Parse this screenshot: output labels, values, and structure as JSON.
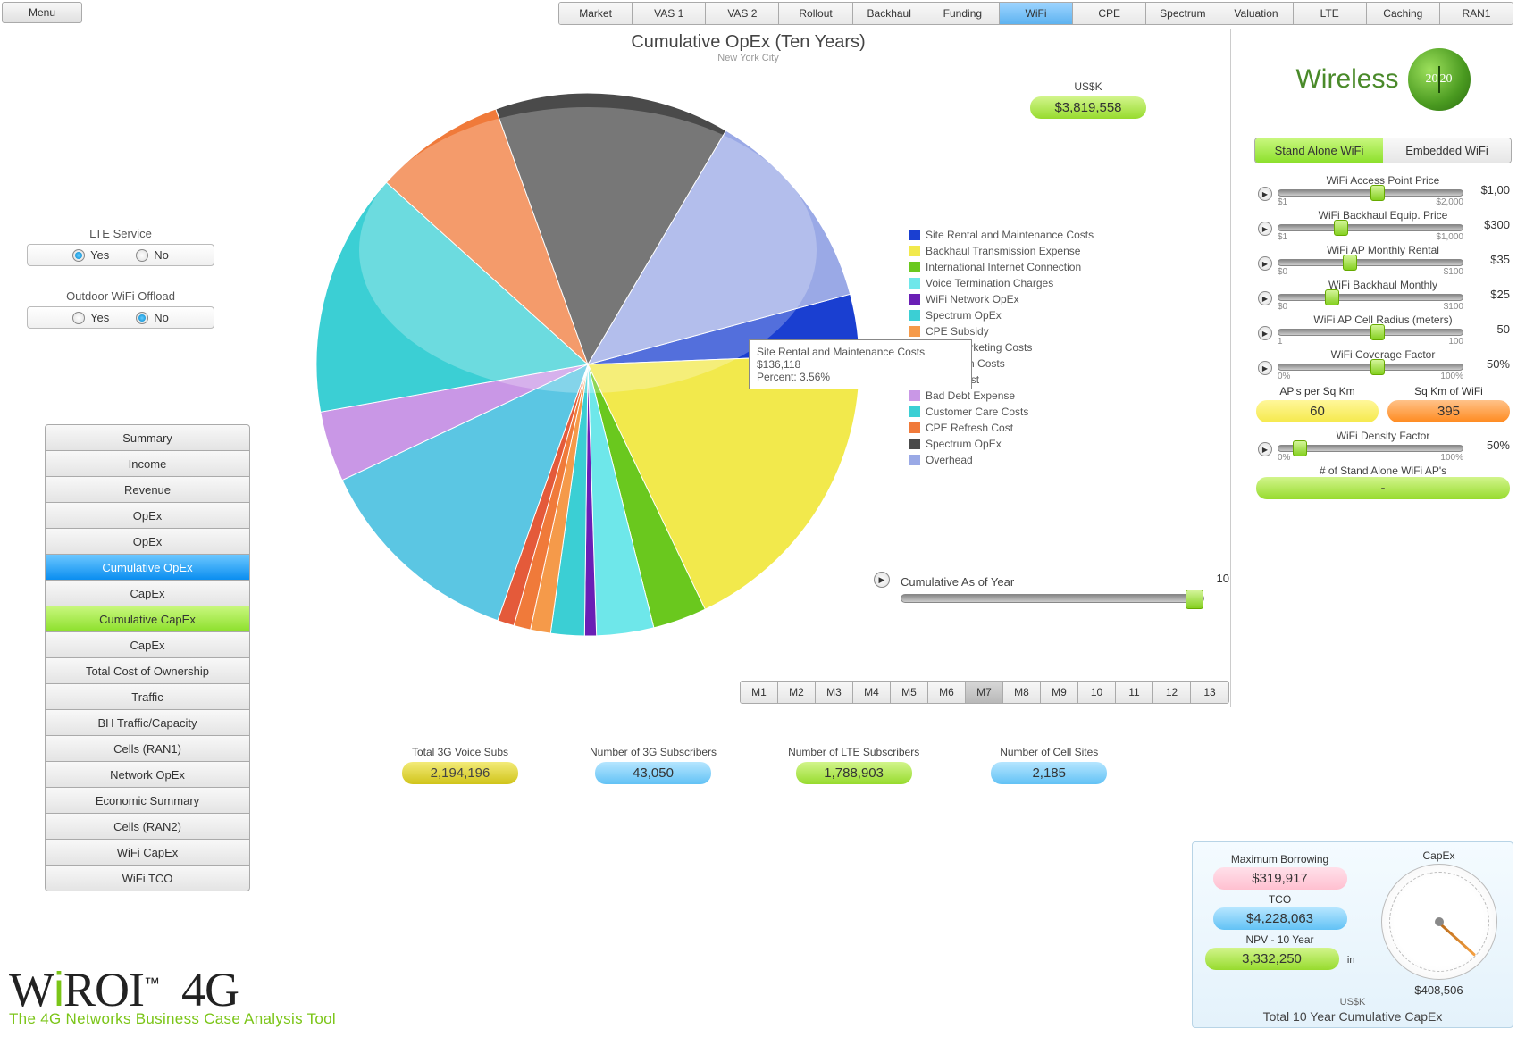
{
  "menu_label": "Menu",
  "tabs": [
    "Market",
    "VAS 1",
    "VAS 2",
    "Rollout",
    "Backhaul",
    "Funding",
    "WiFi",
    "CPE",
    "Spectrum",
    "Valuation",
    "LTE",
    "Caching",
    "RAN1"
  ],
  "active_tab_index": 6,
  "radio_groups": [
    {
      "title": "LTE Service",
      "options": [
        "Yes",
        "No"
      ],
      "selected": 0
    },
    {
      "title": "Outdoor WiFi Offload",
      "options": [
        "Yes",
        "No"
      ],
      "selected": 1
    }
  ],
  "nav_items": [
    "Summary",
    "Income",
    "Revenue",
    "OpEx",
    "OpEx",
    "Cumulative OpEx",
    "CapEx",
    "Cumulative CapEx",
    "CapEx",
    "Total Cost of Ownership",
    "Traffic",
    "BH Traffic/Capacity",
    "Cells (RAN1)",
    "Network OpEx",
    "Economic Summary",
    "Cells (RAN2)",
    "WiFi CapEx",
    "WiFi TCO"
  ],
  "nav_selected_index": 5,
  "nav_green_index": 7,
  "brand": {
    "big_a": "W",
    "big_b": "ROI",
    "dot": "i",
    "suffix": "  4G",
    "tm": "™",
    "sub": "The 4G Networks Business Case Analysis Tool"
  },
  "chart": {
    "title": "Cumulative OpEx (Ten Years)",
    "subtitle": "New York City",
    "tooltip_name": "Site Rental and Maintenance Costs",
    "tooltip_value": "$136,118",
    "tooltip_pct": "Percent: 3.56%"
  },
  "usk_label": "US$K",
  "usk_value": "$3,819,558",
  "cum_label": "Cumulative As of Year",
  "cum_value": "10",
  "m_buttons": [
    "M1",
    "M2",
    "M3",
    "M4",
    "M5",
    "M6",
    "M7",
    "M8",
    "M9",
    "10",
    "11",
    "12",
    "13"
  ],
  "m_selected": "M7",
  "chart_data": {
    "type": "pie",
    "title": "Cumulative OpEx (Ten Years)",
    "categories": [
      "Site Rental and Maintenance Costs",
      "Backhaul Transmission Expense",
      "International Internet Connection",
      "Voice Termination Charges",
      "WiFi Network OpEx",
      "Spectrum OpEx",
      "CPE Subsidy",
      "Fixed Marketing Costs",
      "Promotion Costs",
      "Billing Cost",
      "Bad Debt Expense",
      "Customer Care Costs",
      "CPE Refresh Cost",
      "Spectrum OpEx",
      "Overhead"
    ],
    "colors": [
      "#1a3fd1",
      "#f2e94c",
      "#6ac81e",
      "#6ee7ea",
      "#6a1fb5",
      "#3bcfd4",
      "#f59a4a",
      "#f07a3a",
      "#e45a3a",
      "#5bc6e3",
      "#c997e6",
      "#3bcfd4",
      "#f07a3a",
      "#4a4a4a",
      "#9aa9e6"
    ],
    "values": [
      3.56,
      18.5,
      3.2,
      3.4,
      0.7,
      2.0,
      1.2,
      1.0,
      1.0,
      12.6,
      4.2,
      14.5,
      7.8,
      14.0,
      12.34
    ],
    "total_label": "US$K",
    "total_value": 3819558
  },
  "stats": [
    {
      "label": "Total 3G Voice Subs",
      "value": "2,194,196",
      "style": "yellow"
    },
    {
      "label": "Number of 3G Subscribers",
      "value": "43,050",
      "style": "blue"
    },
    {
      "label": "Number of LTE Subscribers",
      "value": "1,788,903",
      "style": "green"
    },
    {
      "label": "Number of Cell Sites",
      "value": "2,185",
      "style": "blue"
    }
  ],
  "brand2020": "Wireless",
  "wifi_tabs": [
    "Stand Alone WiFi",
    "Embedded WiFi"
  ],
  "wifi_tab_active": 0,
  "sliders": [
    {
      "label": "WiFi Access Point Price",
      "min": "$1",
      "max": "$2,000",
      "val": "$1,00",
      "pct": 50
    },
    {
      "label": "WiFi Backhaul Equip. Price",
      "min": "$1",
      "max": "$1,000",
      "val": "$300",
      "pct": 30
    },
    {
      "label": "WiFi AP Monthly Rental",
      "min": "$0",
      "max": "$100",
      "val": "$35",
      "pct": 35
    },
    {
      "label": "WiFi Backhaul Monthly",
      "min": "$0",
      "max": "$100",
      "val": "$25",
      "pct": 25
    },
    {
      "label": "WiFi AP Cell Radius (meters)",
      "min": "1",
      "max": "100",
      "val": "50",
      "pct": 50
    },
    {
      "label": "WiFi Coverage Factor",
      "min": "0%",
      "max": "100%",
      "val": "50%",
      "pct": 50
    }
  ],
  "ap_cells": [
    {
      "label": "AP's per Sq Km",
      "value": "60",
      "style": "ygreen"
    },
    {
      "label": "Sq Km of WiFi",
      "value": "395",
      "style": "orange"
    }
  ],
  "density": {
    "label": "WiFi Density Factor",
    "min": "0%",
    "max": "100%",
    "val": "50%",
    "pct": 8
  },
  "standalone": {
    "label": "# of Stand Alone WiFi AP's",
    "value": "-"
  },
  "brbox": {
    "max_borrow_lbl": "Maximum Borrowing",
    "max_borrow": "$319,917",
    "tco_lbl": "TCO",
    "tco": "$4,228,063",
    "npv_lbl": "NPV - 10 Year",
    "npv": "3,332,250",
    "in": "in",
    "usk": "US$K",
    "gauge_title": "CapEx",
    "gauge_val": "$408,506",
    "footer": "Total 10 Year Cumulative CapEx"
  }
}
